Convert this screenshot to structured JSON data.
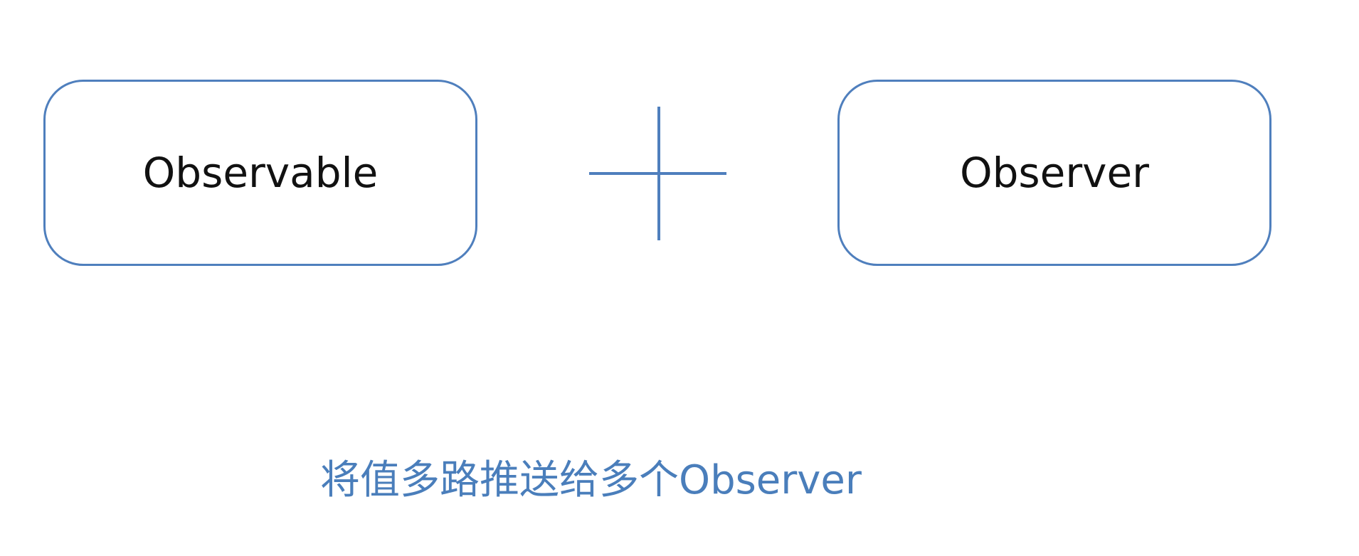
{
  "diagram": {
    "left_box": "Observable",
    "right_box": "Observer",
    "operator": "plus",
    "caption": "将值多路推送给多个Observer",
    "colors": {
      "accent": "#4f7fbd",
      "caption": "#4a7ebb",
      "text": "#111111"
    }
  }
}
